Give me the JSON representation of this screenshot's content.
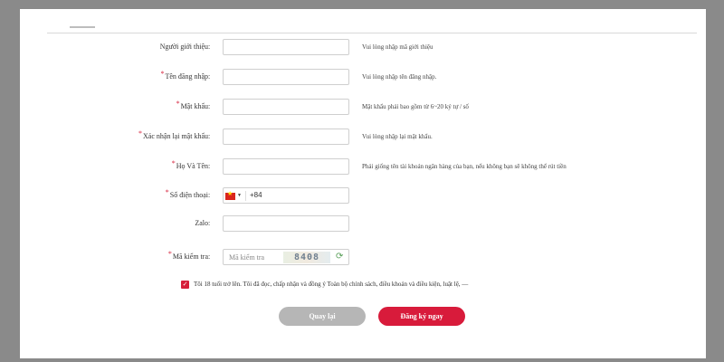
{
  "form": {
    "fields": [
      {
        "label": "Người giới thiệu",
        "required": false,
        "value": "",
        "hint": "Vui lòng nhập mã giới thiệu"
      },
      {
        "label": "Tên đăng nhập",
        "required": true,
        "value": "",
        "hint": "Vui lòng nhập tên đăng nhập."
      },
      {
        "label": "Mật khẩu",
        "required": true,
        "value": "",
        "hint": "Mật khẩu phải bao gồm từ 6~20 ký tự / số"
      },
      {
        "label": "Xác nhận lại mật khẩu",
        "required": true,
        "value": "",
        "hint": "Vui lòng nhập lại mật khẩu."
      },
      {
        "label": "Họ Và Tên",
        "required": true,
        "value": "",
        "hint": "Phải giống tên tài khoản ngân hàng của bạn, nếu không bạn sẽ không thể rút tiền"
      },
      {
        "label": "Số điện thoại",
        "required": true,
        "value": "",
        "hint": ""
      },
      {
        "label": "Zalo",
        "required": false,
        "value": "",
        "hint": ""
      },
      {
        "label": "Mã kiểm tra",
        "required": true,
        "value": "",
        "hint": ""
      }
    ],
    "colon": ":",
    "required_mark": "*",
    "phone": {
      "prefix": "+84",
      "flag_icon": "vietnam-flag-icon"
    },
    "captcha": {
      "placeholder": "Mã kiểm tra",
      "code": "8408",
      "refresh_icon": "refresh-icon"
    },
    "agree": {
      "checked": true,
      "text": "Tôi 18 tuổi trở lên. Tôi đã đọc, chấp nhận và đồng ý Toàn bộ chính sách, điều khoản và điều kiện, luật lệ, —"
    },
    "buttons": {
      "back": "Quay lại",
      "register": "Đăng ký ngay"
    }
  },
  "colors": {
    "accent": "#d81b3b",
    "back_button": "#b6b6b6",
    "overlay": "#8a8a8a"
  }
}
